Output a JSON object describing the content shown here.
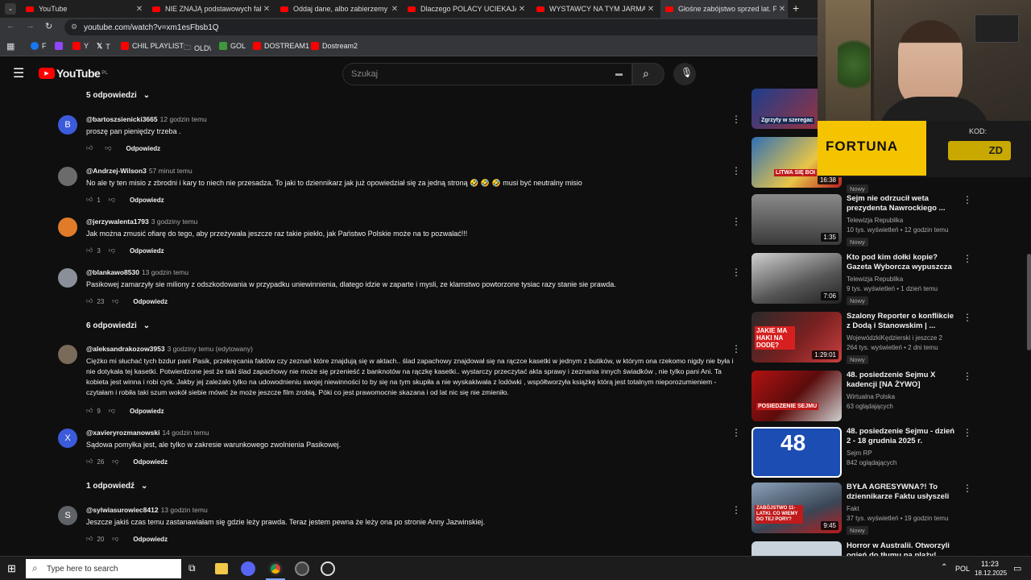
{
  "browser": {
    "tabs": [
      {
        "title": "YouTube"
      },
      {
        "title": "NIE ZNAJĄ podstawowych fakt"
      },
      {
        "title": "Oddaj dane, albo zabierzemy ci"
      },
      {
        "title": "Dlaczego POLACY UCIEKAJĄ z W"
      },
      {
        "title": "WYSTAWCY NA TYM JARMARKU"
      },
      {
        "title": "Głośne zabójstwo sprzed lat. Po"
      }
    ],
    "url": "youtube.com/watch?v=xm1esFbsb1Q",
    "bookmarks": [
      "F",
      "Y",
      "T",
      "CHIL PLAYLIST",
      "OLD\\",
      "GOL",
      "DOSTREAM1",
      "Dostream2"
    ]
  },
  "header": {
    "logo": "YouTube",
    "region": "PL",
    "search_placeholder": "Szukaj"
  },
  "comments": {
    "top_replies": "5 odpowiedzi",
    "reply_label": "Odpowiedz",
    "items": [
      {
        "initial": "B",
        "author": "@bartoszsienicki3665",
        "time": "12 godzin temu",
        "text": "proszę pan pieniędzy trzeba .",
        "likes": ""
      },
      {
        "initial": "",
        "author": "@Andrzej-Wilson3",
        "time": "57 minut temu",
        "text": "No ale ty ten misio  z zbrodni i kary to niech nie  przesadza. To jaki to dziennikarz jak już opowiedział się za jedną stroną  🤣 🤣 🤣 musi być neutralny misio",
        "likes": "1"
      },
      {
        "initial": "",
        "author": "@jerzywalenta1793",
        "time": "3 godziny temu",
        "text": "Jak można zmusić ofiarę do tego, aby przeżywała jeszcze raz takie piekło, jak Państwo Polskie może na to pozwalać!!!",
        "likes": "3"
      },
      {
        "initial": "",
        "author": "@blankawo8530",
        "time": "13 godzin temu",
        "text": "Pasikowej zamarzyły sie miliony z odszkodowania w przypadku uniewinnienia, dlatego idzie w zaparte i mysli, ze klamstwo powtorzone tysiac razy stanie sie prawda.",
        "likes": "23",
        "replies": "6 odpowiedzi"
      },
      {
        "initial": "",
        "author": "@aleksandrakozow3953",
        "time": "3 godziny temu (edytowany)",
        "text": "Ciężko mi słuchać tych bzdur pani Pasik, przekręcania faktów czy zeznań które znajdują się w aktach.. ślad zapachowy znajdował się na rączce kasetki w jednym z butików, w którym ona rzekomo nigdy nie była i nie dotykała tej kasetki. Potwierdzone jest że taki ślad zapachowy nie może się przenieść z banknotów na rączkę kasetki.. wystarczy przeczytać akta sprawy i zeznania innych świadków , nie tylko pani Ani. Ta kobieta jest winna i robi cyrk. Jakby jej zależało tylko na udowodnieniu swojej niewinności to by się na tym skupiła a nie wyskakiwała z lodówki , współtworzyła książkę którą jest totalnym nieporozumieniem - czytałam i robiła taki szum wokół siebie mówić że może jeszcze film zrobią. Póki co jest prawomocnie skazana i od lat nic się nie zmieniło.",
        "likes": "9"
      },
      {
        "initial": "X",
        "author": "@xavieryrozmanowski",
        "time": "14 godzin temu",
        "text": "Sądowa pomyłka jest, ale tylko w zakresie warunkowego zwolnienia Pasikowej.",
        "likes": "26",
        "replies": "1 odpowiedź"
      },
      {
        "initial": "S",
        "author": "@sylwiasurowiec8412",
        "time": "13 godzin temu",
        "text": "Jeszcze jakiś czas temu zastanawiałam się gdzie leży prawda. Teraz jestem pewna że leży ona po stronie Anny Jazwinskiej.",
        "likes": "20"
      }
    ]
  },
  "sidebar": {
    "videos": [
      {
        "title": "",
        "channel": "",
        "meta": "",
        "badge": "",
        "duration": "",
        "thumb_text": "Zgrzyty w szeregac"
      },
      {
        "title": "",
        "channel": "",
        "meta": "",
        "badge": "Nowy",
        "duration": "16:38",
        "thumb_text": "LITWA SIĘ BOI"
      },
      {
        "title": "Sejm nie odrzucił weta prezydenta Nawrockiego ...",
        "channel": "Telewizja Republika",
        "meta": "10 tys. wyświetleń • 12 godzin temu",
        "badge": "Nowy",
        "duration": "1:35"
      },
      {
        "title": "Kto pod kim dołki kopie? Gazeta Wyborcza wypuszcza ...",
        "channel": "Telewizja Republika",
        "meta": "9 tys. wyświetleń • 1 dzień temu",
        "badge": "Nowy",
        "duration": "7:06"
      },
      {
        "title": "Szalony Reporter o konflikcie z Dodą i Stanowskim | ...",
        "channel": "WojewódzkiKędzierski i jeszcze 2",
        "meta": "264 tys. wyświetleń • 2 dni temu",
        "badge": "Nowy",
        "duration": "1:29:01",
        "thumb_text": "JAKIE MA HAKI NA DODĘ?"
      },
      {
        "title": "48. posiedzenie Sejmu X kadencji [NA ŻYWO]",
        "channel": "Wirtualna Polska",
        "meta": "63 oglądających",
        "badge": "",
        "duration": "",
        "thumb_text": "POSIEDZENIE SEJMU"
      },
      {
        "title": "48. posiedzenie Sejmu - dzień 2 - 18 grudnia 2025 r.",
        "channel": "Sejm RP",
        "meta": "842 oglądających",
        "badge": "",
        "duration": "",
        "thumb_text": "48"
      },
      {
        "title": "BYŁA AGRESYWNA?! To dziennikarze Faktu usłyszeli w...",
        "channel": "Fakt",
        "meta": "37 tys. wyświetleń • 19 godzin temu",
        "badge": "Nowy",
        "duration": "9:45",
        "thumb_text": "ZABÓJSTWO 11-LATKI. CO WIEMY DO TEJ PORY?"
      },
      {
        "title": "Horror w Australii. Otworzyli ogień do tłumu na plaży!",
        "channel": "",
        "meta": "",
        "badge": "",
        "duration": ""
      }
    ]
  },
  "overlay": {
    "brand": "FORTUNA",
    "code_label": "KOD:",
    "code_value": "ZD"
  },
  "taskbar": {
    "search_placeholder": "Type here to search",
    "lang": "POL",
    "time": "11:23",
    "date": "18.12.2025"
  },
  "colors": {
    "background": "#0f0f0f",
    "yt_red": "#ff0000",
    "fortuna_yellow": "#f5c400"
  }
}
